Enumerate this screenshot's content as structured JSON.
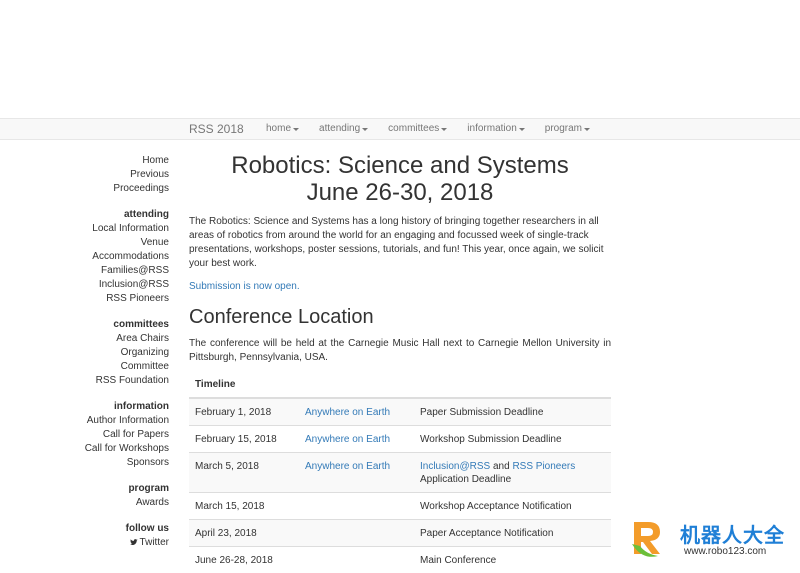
{
  "navbar": {
    "brand": "RSS 2018",
    "items": [
      {
        "label": "home"
      },
      {
        "label": "attending"
      },
      {
        "label": "committees"
      },
      {
        "label": "information"
      },
      {
        "label": "program"
      }
    ]
  },
  "sidebar": {
    "top_links": [
      "Home",
      "Previous",
      "Proceedings"
    ],
    "groups": [
      {
        "heading": "attending",
        "links": [
          "Local Information",
          "Venue",
          "Accommodations",
          "Families@RSS",
          "Inclusion@RSS",
          "RSS Pioneers"
        ]
      },
      {
        "heading": "committees",
        "links": [
          "Area Chairs",
          "Organizing",
          "Committee",
          "RSS Foundation"
        ]
      },
      {
        "heading": "information",
        "links": [
          "Author Information",
          "Call for Papers",
          "Call for Workshops",
          "Sponsors"
        ]
      },
      {
        "heading": "program",
        "links": [
          "Awards"
        ]
      },
      {
        "heading": "follow us",
        "links": [
          "Twitter"
        ]
      }
    ]
  },
  "main": {
    "title_line1": "Robotics: Science and Systems",
    "title_line2": "June 26-30, 2018",
    "intro": "The Robotics: Science and Systems has a long history of bringing together researchers in all areas of robotics from around the world for an engaging and focussed week of single-track presentations, workshops, poster sessions, tutorials, and fun! This year, once again, we solicit your best work.",
    "submission_link": "Submission is now open.",
    "location_heading": "Conference Location",
    "location_text": "The conference will be held at the Carnegie Music Hall next to Carnegie Mellon University in Pittsburgh, Pennsylvania, USA.",
    "timeline": {
      "header": "Timeline",
      "rows": [
        {
          "date": "February 1, 2018",
          "tz": "Anywhere on Earth",
          "event": "Paper Submission Deadline"
        },
        {
          "date": "February 15, 2018",
          "tz": "Anywhere on Earth",
          "event": "Workshop Submission Deadline"
        },
        {
          "date": "March 5, 2018",
          "tz": "Anywhere on Earth",
          "event_link1": "Inclusion@RSS",
          "event_and": " and ",
          "event_link2": "RSS Pioneers",
          "event_rest": "Application Deadline"
        },
        {
          "date": "March 15, 2018",
          "tz": "",
          "event": "Workshop Acceptance Notification"
        },
        {
          "date": "April 23, 2018",
          "tz": "",
          "event": "Paper Acceptance Notification"
        },
        {
          "date": "June 26-28, 2018",
          "tz": "",
          "event": "Main Conference"
        }
      ]
    }
  },
  "watermark": {
    "title": "机器人大全",
    "url": "www.robo123.com"
  },
  "colors": {
    "link": "#337ab7",
    "navbar_bg": "#f8f8f8",
    "text": "#333333"
  }
}
